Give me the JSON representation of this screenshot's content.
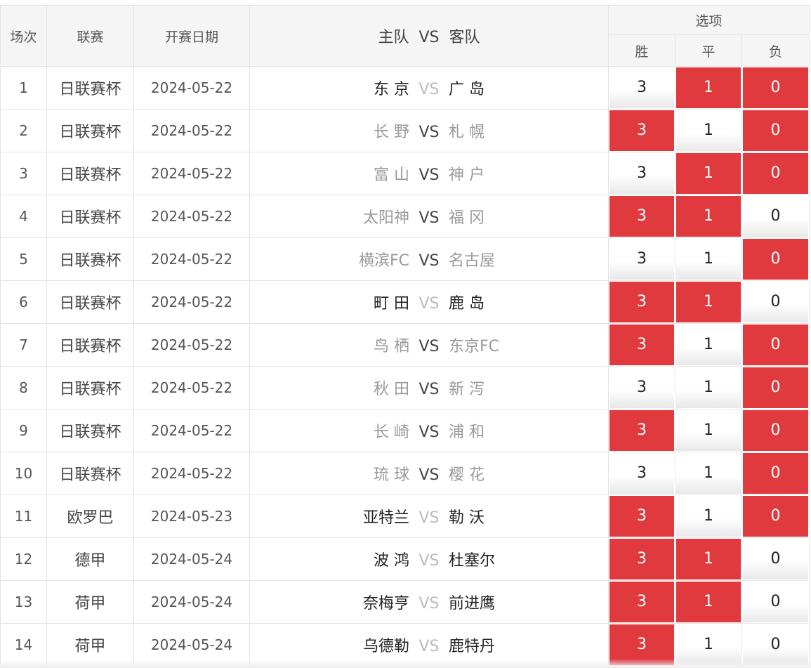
{
  "headers": {
    "index": "场次",
    "league": "联赛",
    "date": "开赛日期",
    "matchup": {
      "home": "主队",
      "vs": "VS",
      "away": "客队"
    },
    "options": "选项",
    "win": "胜",
    "draw": "平",
    "loss": "负"
  },
  "colors": {
    "selected": "#e03a3e",
    "header_bg": "#f5f5f5"
  },
  "rows": [
    {
      "no": "1",
      "league": "日联赛杯",
      "date": "2024-05-22",
      "home": "东 京",
      "away": "广 岛",
      "vs_dim": true,
      "home_dim": false,
      "away_dim": false,
      "win": "3",
      "draw": "1",
      "loss": "0",
      "sel": [
        false,
        true,
        true
      ]
    },
    {
      "no": "2",
      "league": "日联赛杯",
      "date": "2024-05-22",
      "home": "长 野",
      "away": "札 幌",
      "vs_dim": false,
      "home_dim": true,
      "away_dim": true,
      "win": "3",
      "draw": "1",
      "loss": "0",
      "sel": [
        true,
        false,
        true
      ]
    },
    {
      "no": "3",
      "league": "日联赛杯",
      "date": "2024-05-22",
      "home": "富 山",
      "away": "神 户",
      "vs_dim": false,
      "home_dim": true,
      "away_dim": true,
      "win": "3",
      "draw": "1",
      "loss": "0",
      "sel": [
        false,
        true,
        true
      ]
    },
    {
      "no": "4",
      "league": "日联赛杯",
      "date": "2024-05-22",
      "home": "太阳神",
      "away": "福 冈",
      "vs_dim": false,
      "home_dim": true,
      "away_dim": true,
      "win": "3",
      "draw": "1",
      "loss": "0",
      "sel": [
        true,
        true,
        false
      ]
    },
    {
      "no": "5",
      "league": "日联赛杯",
      "date": "2024-05-22",
      "home": "横滨FC",
      "away": "名古屋",
      "vs_dim": false,
      "home_dim": true,
      "away_dim": true,
      "win": "3",
      "draw": "1",
      "loss": "0",
      "sel": [
        false,
        false,
        true
      ]
    },
    {
      "no": "6",
      "league": "日联赛杯",
      "date": "2024-05-22",
      "home": "町 田",
      "away": "鹿 岛",
      "vs_dim": true,
      "home_dim": false,
      "away_dim": false,
      "win": "3",
      "draw": "1",
      "loss": "0",
      "sel": [
        true,
        true,
        false
      ]
    },
    {
      "no": "7",
      "league": "日联赛杯",
      "date": "2024-05-22",
      "home": "鸟 栖",
      "away": "东京FC",
      "vs_dim": false,
      "home_dim": true,
      "away_dim": true,
      "win": "3",
      "draw": "1",
      "loss": "0",
      "sel": [
        true,
        false,
        true
      ]
    },
    {
      "no": "8",
      "league": "日联赛杯",
      "date": "2024-05-22",
      "home": "秋 田",
      "away": "新 泻",
      "vs_dim": false,
      "home_dim": true,
      "away_dim": true,
      "win": "3",
      "draw": "1",
      "loss": "0",
      "sel": [
        false,
        false,
        true
      ]
    },
    {
      "no": "9",
      "league": "日联赛杯",
      "date": "2024-05-22",
      "home": "长 崎",
      "away": "浦 和",
      "vs_dim": false,
      "home_dim": true,
      "away_dim": true,
      "win": "3",
      "draw": "1",
      "loss": "0",
      "sel": [
        true,
        false,
        true
      ]
    },
    {
      "no": "10",
      "league": "日联赛杯",
      "date": "2024-05-22",
      "home": "琉 球",
      "away": "樱 花",
      "vs_dim": false,
      "home_dim": true,
      "away_dim": true,
      "win": "3",
      "draw": "1",
      "loss": "0",
      "sel": [
        false,
        false,
        true
      ]
    },
    {
      "no": "11",
      "league": "欧罗巴",
      "date": "2024-05-23",
      "home": "亚特兰",
      "away": "勒 沃",
      "vs_dim": true,
      "home_dim": false,
      "away_dim": false,
      "win": "3",
      "draw": "1",
      "loss": "0",
      "sel": [
        true,
        false,
        true
      ]
    },
    {
      "no": "12",
      "league": "德甲",
      "date": "2024-05-24",
      "home": "波 鸿",
      "away": "杜塞尔",
      "vs_dim": true,
      "home_dim": false,
      "away_dim": false,
      "win": "3",
      "draw": "1",
      "loss": "0",
      "sel": [
        true,
        true,
        false
      ]
    },
    {
      "no": "13",
      "league": "荷甲",
      "date": "2024-05-24",
      "home": "奈梅亨",
      "away": "前进鹰",
      "vs_dim": true,
      "home_dim": false,
      "away_dim": false,
      "win": "3",
      "draw": "1",
      "loss": "0",
      "sel": [
        true,
        true,
        false
      ]
    },
    {
      "no": "14",
      "league": "荷甲",
      "date": "2024-05-24",
      "home": "乌德勒",
      "away": "鹿特丹",
      "vs_dim": true,
      "home_dim": false,
      "away_dim": false,
      "win": "3",
      "draw": "1",
      "loss": "0",
      "sel": [
        true,
        false,
        false
      ]
    }
  ]
}
